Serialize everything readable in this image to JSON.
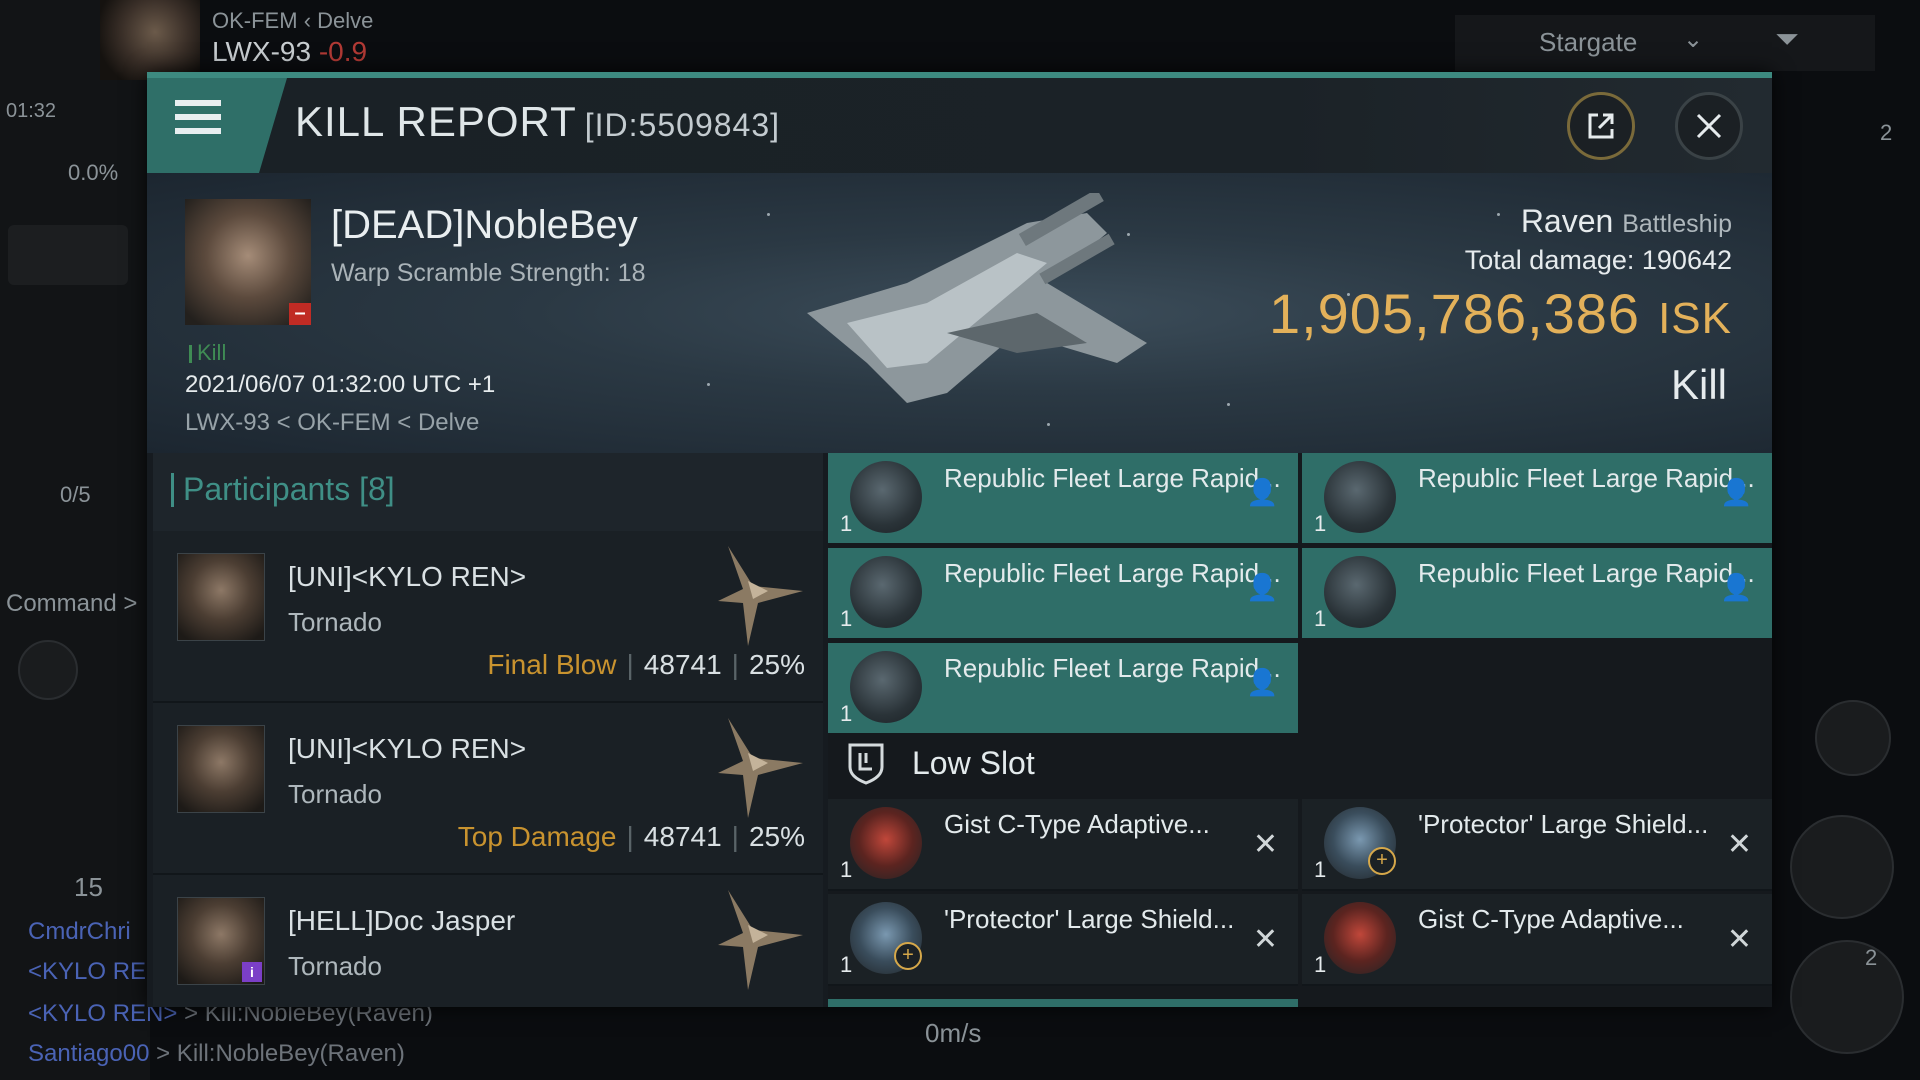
{
  "hud": {
    "region_path": "OK-FEM",
    "region_parent": "Delve",
    "system": "LWX-93",
    "security": "-0.9",
    "time": "01:32",
    "cargo_pct": "0.0%",
    "fleet_slots": "0/5",
    "command_label": "Command >",
    "local_count": "15",
    "speed": "0m/s",
    "stargate_label": "Stargate",
    "notifications_count": "2",
    "drone_count": "2",
    "chat": [
      {
        "name": "CmdrChri",
        "text": ""
      },
      {
        "name": "<KYLO RE",
        "text": ""
      },
      {
        "name": "<KYLO REN>",
        "text": " > Kill:NobleBey(Raven)"
      },
      {
        "name": "Santiago00",
        "text": " > Kill:NobleBey(Raven)"
      }
    ]
  },
  "report": {
    "title": "KILL REPORT",
    "id_label": "[ID:5509843]",
    "victim": {
      "name": "[DEAD]NobleBey",
      "subtitle": "Warp Scramble Strength: 18",
      "kill_tag": "Kill",
      "datetime": "2021/06/07 01:32:00 UTC +1",
      "location": "LWX-93 < OK-FEM < Delve",
      "ship_name": "Raven",
      "ship_class": "Battleship",
      "total_damage_label": "Total damage:",
      "total_damage": "190642",
      "isk_value": "1,905,786,386",
      "isk_unit": "ISK",
      "result": "Kill"
    },
    "participants": {
      "title": "Participants [8]",
      "rows": [
        {
          "name": "[UNI]<KYLO REN>",
          "ship": "Tornado",
          "tag": "Final Blow",
          "damage": "48741",
          "pct": "25%"
        },
        {
          "name": "[UNI]<KYLO REN>",
          "ship": "Tornado",
          "tag": "Top Damage",
          "damage": "48741",
          "pct": "25%"
        },
        {
          "name": "[HELL]Doc Jasper",
          "ship": "Tornado",
          "tag": "",
          "damage": "",
          "pct": ""
        }
      ]
    },
    "modules": {
      "high": [
        {
          "name": "Republic Fleet Large Rapid...",
          "qty": "1"
        },
        {
          "name": "Republic Fleet Large Rapid...",
          "qty": "1"
        },
        {
          "name": "Republic Fleet Large Rapid...",
          "qty": "1"
        },
        {
          "name": "Republic Fleet Large Rapid...",
          "qty": "1"
        },
        {
          "name": "Republic Fleet Large Rapid...",
          "qty": "1"
        }
      ],
      "low_title": "Low Slot",
      "low": [
        {
          "name": "Gist C-Type Adaptive...",
          "qty": "1"
        },
        {
          "name": "'Protector' Large Shield...",
          "qty": "1"
        },
        {
          "name": "'Protector' Large Shield...",
          "qty": "1"
        },
        {
          "name": "Gist C-Type Adaptive...",
          "qty": "1"
        }
      ]
    }
  },
  "colors": {
    "accent_teal": "#2f6e68",
    "isk_gold": "#e3b15a",
    "tag_orange": "#c9932f",
    "security_red": "#b23a35",
    "kill_green": "#3f8b54"
  }
}
